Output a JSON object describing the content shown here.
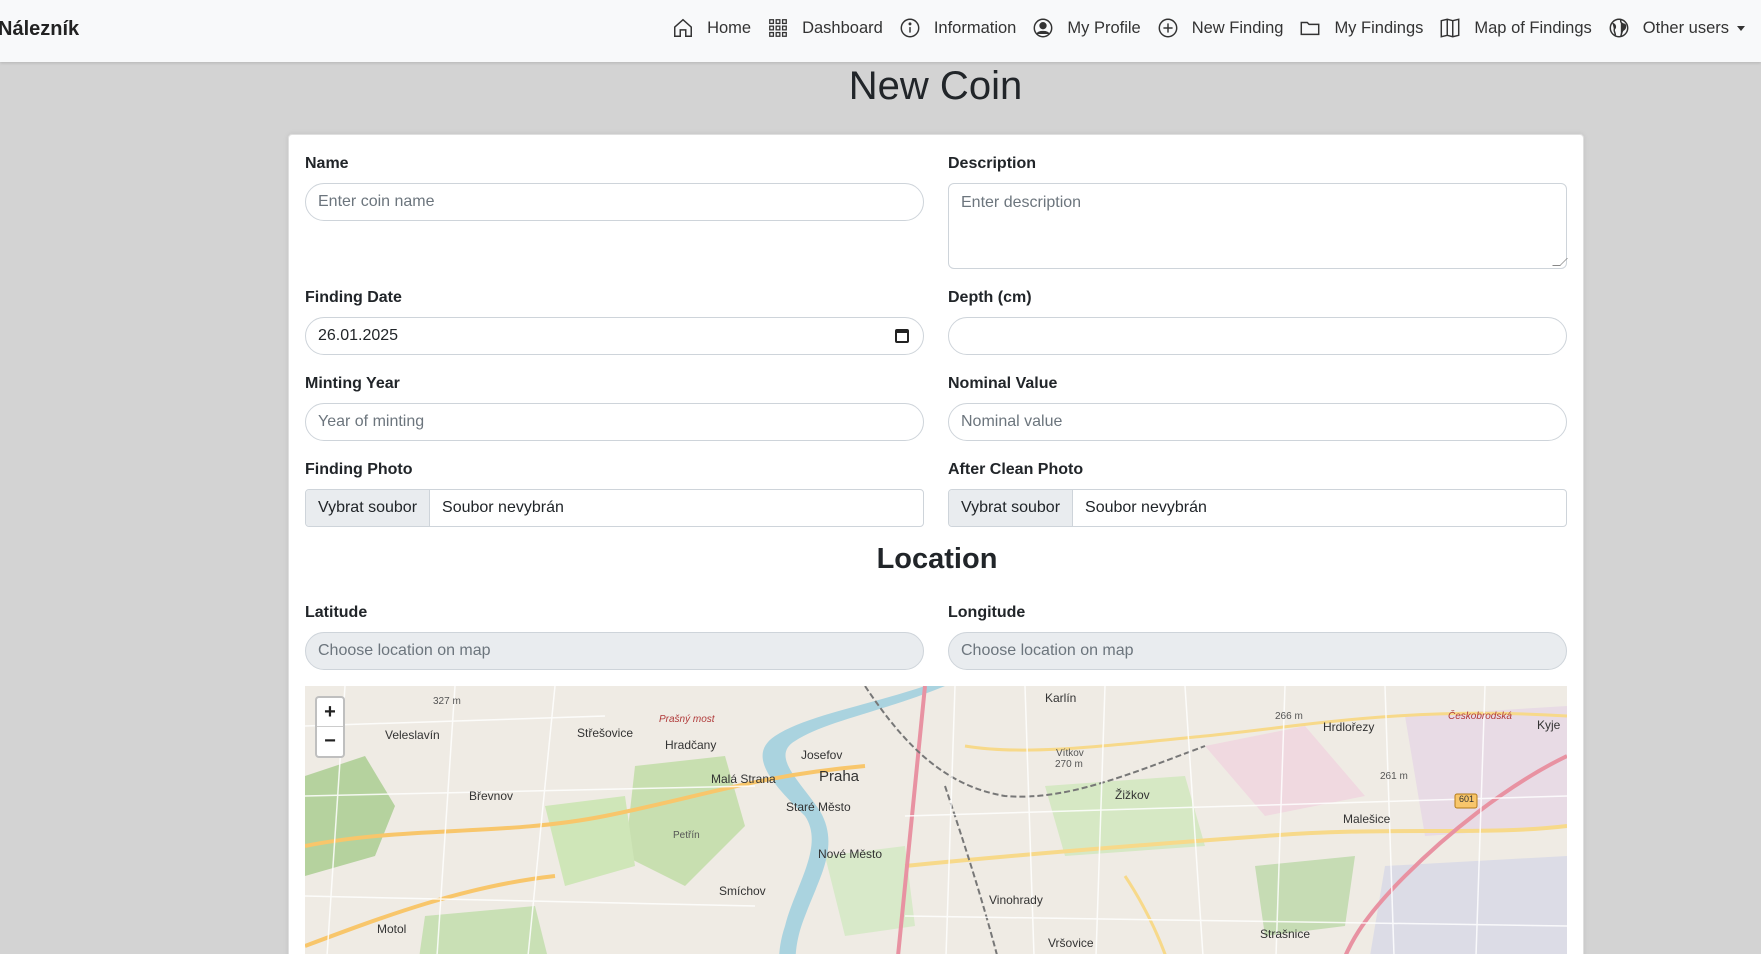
{
  "brand": "Nálezník",
  "nav": {
    "home": "Home",
    "dashboard": "Dashboard",
    "information": "Information",
    "my_profile": "My Profile",
    "new_finding": "New Finding",
    "my_findings": "My Findings",
    "map_of_findings": "Map of Findings",
    "other_users": "Other users"
  },
  "page_title": "New Coin",
  "form": {
    "name_label": "Name",
    "name_placeholder": "Enter coin name",
    "description_label": "Description",
    "description_placeholder": "Enter description",
    "finding_date_label": "Finding Date",
    "finding_date_value": "26.01.2025",
    "depth_label": "Depth (cm)",
    "depth_value": "",
    "minting_year_label": "Minting Year",
    "minting_year_placeholder": "Year of minting",
    "nominal_value_label": "Nominal Value",
    "nominal_value_placeholder": "Nominal value",
    "finding_photo_label": "Finding Photo",
    "after_clean_photo_label": "After Clean Photo",
    "file_button": "Vybrat soubor",
    "file_none": "Soubor nevybrán"
  },
  "location": {
    "title": "Location",
    "latitude_label": "Latitude",
    "longitude_label": "Longitude",
    "coord_placeholder": "Choose location on map"
  },
  "map": {
    "zoom_in": "+",
    "zoom_out": "−",
    "labels": {
      "karlin": "Karlín",
      "veleslavin": "Veleslavín",
      "stresovice": "Střešovice",
      "hradcany": "Hradčany",
      "josefov": "Josefov",
      "praha": "Praha",
      "mala_strana": "Malá Strana",
      "brevnov": "Břevnov",
      "stare_mesto": "Staré Město",
      "nove_mesto": "Nové Město",
      "smichov": "Smíchov",
      "motol": "Motol",
      "vinohrady": "Vinohrady",
      "zizkov": "Žižkov",
      "hrdlorezy": "Hrdlořezy",
      "malesice": "Malešice",
      "strasnice": "Strašnice",
      "vrsovice": "Vršovice",
      "kyje": "Kyje",
      "prasny_most": "Prašný most",
      "petrin": "Petřín",
      "vitkov": "Vítkov",
      "ceskobrodska": "Českobrodská",
      "elev_327": "327 m",
      "elev_270": "270 m",
      "elev_266": "266 m",
      "elev_261": "261 m",
      "road_601": "601"
    }
  },
  "colors": {
    "navbar_bg": "#f8f9fa",
    "page_bg": "#d3d3d3",
    "input_readonly_bg": "#e9ecef"
  }
}
